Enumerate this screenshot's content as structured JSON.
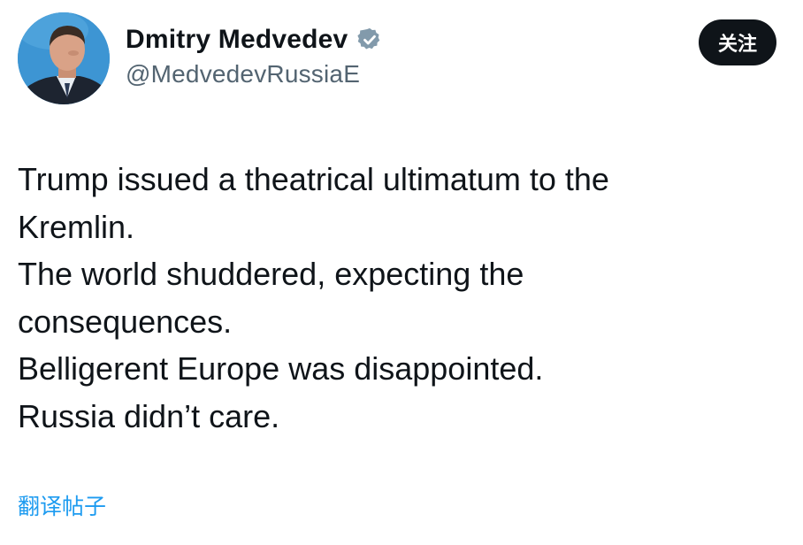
{
  "profile": {
    "display_name": "Dmitry Medvedev",
    "handle": "@MedvedevRussiaE",
    "verified_icon": "verified-badge-icon",
    "avatar_icon": "profile-photo"
  },
  "actions": {
    "follow_label": "关注"
  },
  "tweet": {
    "lines": [
      "Trump issued a theatrical ultimatum to the",
      "Kremlin.",
      "The world shuddered, expecting the",
      "consequences.",
      "Belligerent Europe was disappointed.",
      "Russia didn’t care."
    ],
    "translate_label": "翻译帖子"
  },
  "colors": {
    "text_primary": "#0f1419",
    "text_secondary": "#536471",
    "accent": "#1d9bf0",
    "button_bg": "#0f1419",
    "verified_badge": "#829aab"
  }
}
